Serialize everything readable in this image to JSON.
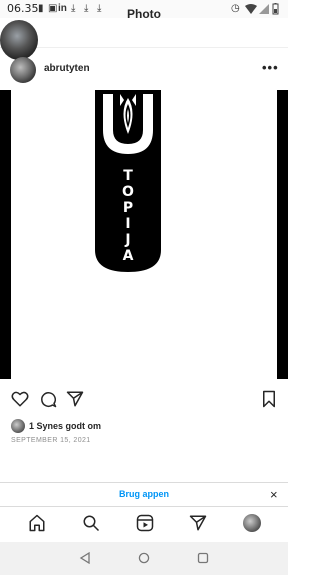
{
  "status_bar": {
    "time": "06.35",
    "icons": [
      "sim-icon",
      "notification-icon",
      "linkedin-icon",
      "download-icon",
      "download-icon",
      "download-icon",
      "alarm-icon",
      "wifi-icon",
      "signal-icon",
      "battery-icon"
    ]
  },
  "header": {
    "title": "Photo"
  },
  "post": {
    "username": "abrutyten",
    "image_text": {
      "letters": [
        "T",
        "O",
        "P",
        "I",
        "J",
        "A"
      ]
    },
    "likes": "1 Synes godt om",
    "date": "SEPTEMBER 15, 2021"
  },
  "app_banner": {
    "label": "Brug appen",
    "close": "×"
  },
  "colors": {
    "accent": "#0095f6",
    "text": "#262626",
    "muted": "#8e8e8e"
  }
}
